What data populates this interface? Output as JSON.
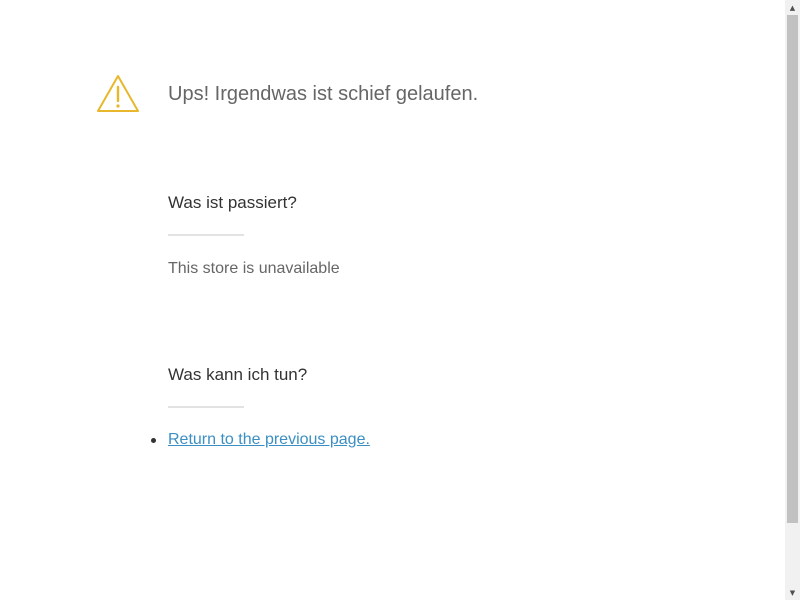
{
  "error": {
    "icon": "warning-triangle-icon",
    "icon_color": "#e8b72c",
    "title": "Ups! Irgendwas ist schief gelaufen."
  },
  "what_happened": {
    "heading": "Was ist passiert?",
    "message": "This store is unavailable"
  },
  "what_to_do": {
    "heading": "Was kann ich tun?",
    "actions": [
      {
        "label": "Return to the previous page."
      }
    ]
  },
  "colors": {
    "link": "#3b8fc3",
    "title_text": "#666666",
    "heading_text": "#333333",
    "divider": "#e2e2e2"
  },
  "scrollbar": {
    "up_icon": "scroll-up-arrow-icon",
    "down_icon": "scroll-down-arrow-icon"
  }
}
